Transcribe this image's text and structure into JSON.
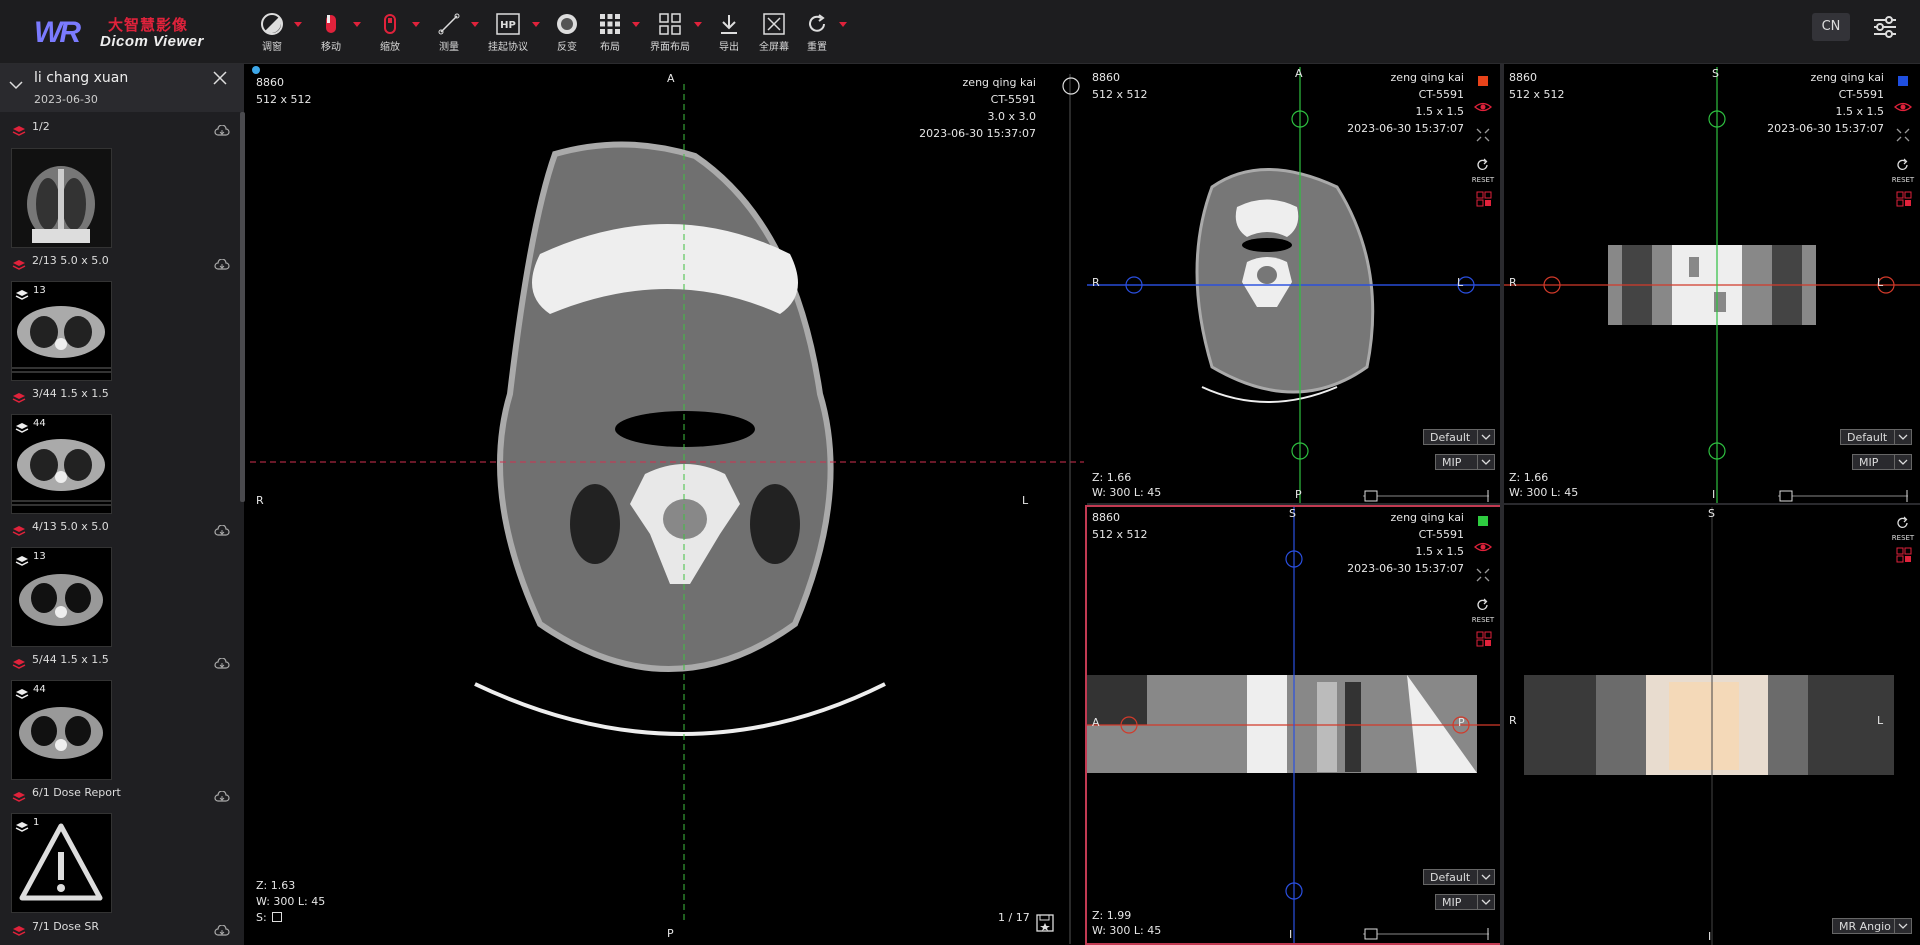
{
  "app": {
    "logo_mark": "WR",
    "logo_cn": "大智慧影像",
    "logo_en": "Dicom Viewer",
    "lang_button": "CN"
  },
  "toolbar": {
    "items": [
      {
        "label": "调窗",
        "icon": "contrast-icon"
      },
      {
        "label": "移动",
        "icon": "pan-icon"
      },
      {
        "label": "缩放",
        "icon": "zoom-icon"
      },
      {
        "label": "测量",
        "icon": "measure-icon"
      },
      {
        "label": "挂起协议",
        "icon": "hanging-protocol-icon"
      },
      {
        "label": "反变",
        "icon": "invert-icon"
      },
      {
        "label": "布局",
        "icon": "grid-icon"
      },
      {
        "label": "界面布局",
        "icon": "layout-icon"
      },
      {
        "label": "导出",
        "icon": "download-icon"
      },
      {
        "label": "全屏幕",
        "icon": "fullscreen-icon"
      },
      {
        "label": "重置",
        "icon": "reset-icon"
      }
    ]
  },
  "patient": {
    "name": "li chang xuan",
    "date": "2023-06-30"
  },
  "series": [
    {
      "label": "1/2",
      "count": "2"
    },
    {
      "label": "2/13 5.0 x 5.0",
      "count": "13"
    },
    {
      "label": "3/44 1.5 x 1.5",
      "count": "44"
    },
    {
      "label": "4/13 5.0 x 5.0",
      "count": "13"
    },
    {
      "label": "5/44 1.5 x 1.5",
      "count": "44"
    },
    {
      "label": "6/1 Dose Report",
      "count": "1"
    },
    {
      "label": "7/1 Dose SR",
      "count": ""
    }
  ],
  "main_view": {
    "top_left": [
      "8860",
      "512 x 512"
    ],
    "top_right": [
      "zeng qing kai",
      "CT-5591",
      "3.0 x 3.0",
      "2023-06-30 15:37:07"
    ],
    "orient": {
      "top": "A",
      "bottom": "P",
      "left": "R",
      "right": "L"
    },
    "zoom": "Z: 1.63",
    "window": "W: 300 L: 45",
    "s_label": "S:",
    "frame": "1 / 17"
  },
  "axial_view": {
    "top_left": [
      "8860",
      "512 x 512"
    ],
    "top_right": [
      "zeng qing kai",
      "CT-5591",
      "1.5 x 1.5",
      "2023-06-30 15:37:07"
    ],
    "orient": {
      "top": "A",
      "bottom": "P",
      "left": "R",
      "right": "L"
    },
    "zoom": "Z: 1.66",
    "window": "W: 300 L: 45",
    "preset": "Default",
    "mode": "MIP",
    "reset": "RESET",
    "color": "#e8431a"
  },
  "coronal_view": {
    "top_left": [
      "8860",
      "512 x 512"
    ],
    "top_right": [
      "zeng qing kai",
      "CT-5591",
      "1.5 x 1.5",
      "2023-06-30 15:37:07"
    ],
    "orient": {
      "top": "S",
      "bottom": "I",
      "left": "R",
      "right": "L"
    },
    "zoom": "Z: 1.66",
    "window": "W: 300 L: 45",
    "preset": "Default",
    "mode": "MIP",
    "reset": "RESET",
    "color": "#1f4fe0"
  },
  "sagittal_view": {
    "top_left": [
      "8860",
      "512 x 512"
    ],
    "top_right": [
      "zeng qing kai",
      "CT-5591",
      "1.5 x 1.5",
      "2023-06-30 15:37:07"
    ],
    "orient": {
      "top": "S",
      "bottom": "I",
      "left": "A",
      "right": "P"
    },
    "zoom": "Z: 1.99",
    "window": "W: 300 L: 45",
    "preset": "Default",
    "mode": "MIP",
    "reset": "RESET",
    "color": "#2ecc40"
  },
  "volume_view": {
    "orient": {
      "top": "S",
      "bottom": "I",
      "left": "R",
      "right": "L"
    },
    "reset": "RESET",
    "preset": "MR Angio"
  }
}
